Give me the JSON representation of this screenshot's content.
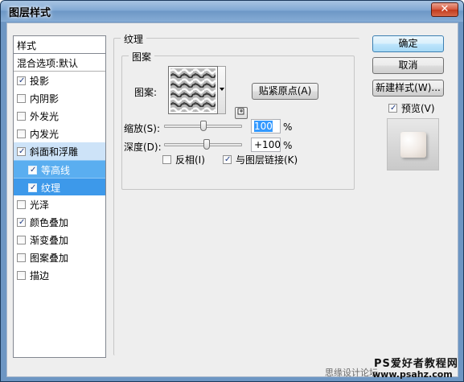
{
  "window": {
    "title": "图层样式",
    "close_label": "✕"
  },
  "style_list": {
    "header": "样式",
    "blend_options": "混合选项:默认",
    "items": [
      {
        "label": "投影",
        "checked": true
      },
      {
        "label": "内阴影",
        "checked": false
      },
      {
        "label": "外发光",
        "checked": false
      },
      {
        "label": "内发光",
        "checked": false
      },
      {
        "label": "斜面和浮雕",
        "checked": true
      },
      {
        "label": "等高线",
        "checked": true
      },
      {
        "label": "纹理",
        "checked": true
      },
      {
        "label": "光泽",
        "checked": false
      },
      {
        "label": "颜色叠加",
        "checked": true
      },
      {
        "label": "渐变叠加",
        "checked": false
      },
      {
        "label": "图案叠加",
        "checked": false
      },
      {
        "label": "描边",
        "checked": false
      }
    ]
  },
  "texture": {
    "group_title": "纹理",
    "subgroup_title": "图案",
    "pattern_label": "图案:",
    "snap_origin_label": "贴紧原点(A)",
    "scale_label": "缩放(S):",
    "scale_value": "100",
    "scale_unit": "%",
    "scale_level": 0.5,
    "depth_label": "深度(D):",
    "depth_value": "+100",
    "depth_unit": "%",
    "invert_label": "反相(I)",
    "invert_checked": false,
    "link_label": "与图层链接(K)",
    "link_checked": true
  },
  "buttons": {
    "ok": "确定",
    "cancel": "取消",
    "new_style": "新建样式(W)...",
    "preview_label": "预览(V)",
    "preview_checked": true
  },
  "watermark": {
    "line1": "PS爱好者教程网",
    "line2": "www.psahz.com",
    "line3": "思缘设计论坛"
  }
}
